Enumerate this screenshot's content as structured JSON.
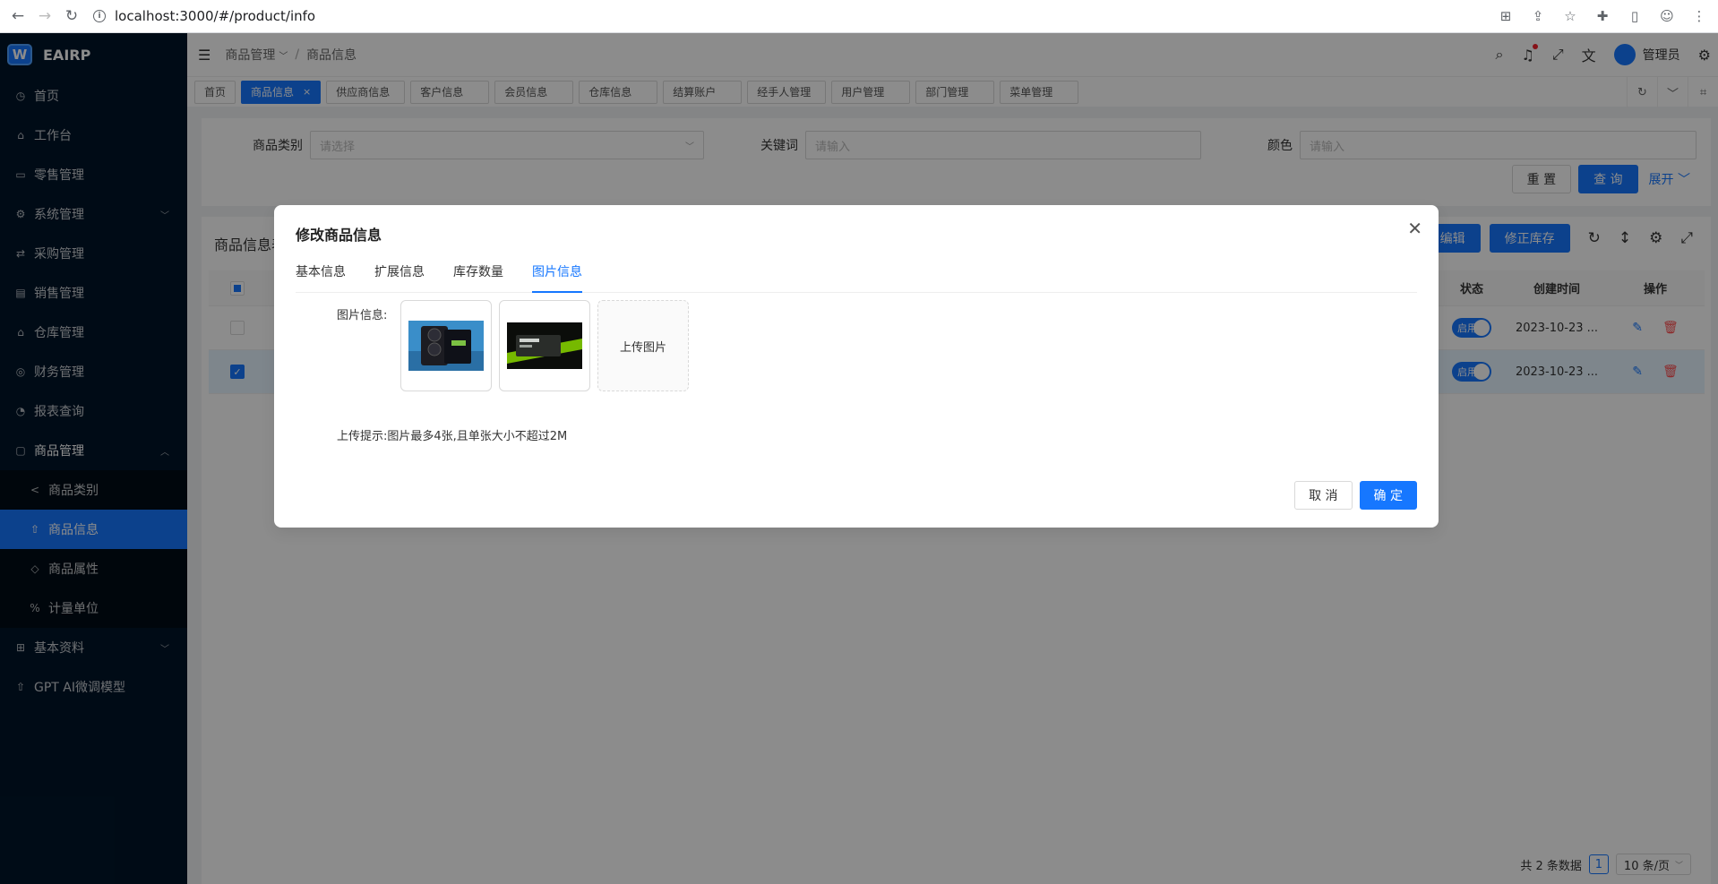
{
  "browser": {
    "url": "localhost:3000/#/product/info"
  },
  "sidebar": {
    "logo": "EAIRP",
    "items": [
      {
        "label": "首页",
        "icon": "dashboard-icon"
      },
      {
        "label": "工作台",
        "icon": "home-icon"
      },
      {
        "label": "零售管理",
        "icon": "folder-icon"
      },
      {
        "label": "系统管理",
        "icon": "gear-icon"
      },
      {
        "label": "采购管理",
        "icon": "swap-icon"
      },
      {
        "label": "销售管理",
        "icon": "bank-icon"
      },
      {
        "label": "仓库管理",
        "icon": "warehouse-icon"
      },
      {
        "label": "财务管理",
        "icon": "finance-icon"
      },
      {
        "label": "报表查询",
        "icon": "report-icon"
      },
      {
        "label": "商品管理",
        "icon": "shopping-icon"
      }
    ],
    "sub_items": [
      {
        "label": "商品类别",
        "icon": "share-icon"
      },
      {
        "label": "商品信息",
        "icon": "rocket-icon"
      },
      {
        "label": "商品属性",
        "icon": "tag-icon"
      },
      {
        "label": "计量单位",
        "icon": "percent-icon"
      }
    ],
    "bottom_items": [
      {
        "label": "基本资料",
        "icon": "grid-icon"
      },
      {
        "label": "GPT AI微调模型",
        "icon": "rocket-icon"
      }
    ]
  },
  "header": {
    "breadcrumb_parent": "商品管理",
    "breadcrumb_current": "商品信息",
    "user_name": "管理员"
  },
  "tabs": [
    "首页",
    "商品信息",
    "供应商信息",
    "客户信息",
    "会员信息",
    "仓库信息",
    "结算账户",
    "经手人管理",
    "用户管理",
    "部门管理",
    "菜单管理"
  ],
  "search": {
    "category_label": "商品类别",
    "category_placeholder": "请选择",
    "keyword_label": "关键词",
    "keyword_placeholder": "请输入",
    "color_label": "颜色",
    "color_placeholder": "请输入",
    "reset_label": "重 置",
    "query_label": "查 询",
    "expand_label": "展开"
  },
  "table": {
    "title": "商品信息表",
    "edit_label": "编辑",
    "fix_stock_label": "修正库存",
    "col_status": "状态",
    "col_created": "创建时间",
    "col_ops": "操作",
    "rows": [
      {
        "status": "启用",
        "created": "2023-10-23 ..."
      },
      {
        "status": "启用",
        "created": "2023-10-23 ..."
      }
    ],
    "total_text": "共 2 条数据",
    "page": "1",
    "page_size": "10 条/页"
  },
  "modal": {
    "title": "修改商品信息",
    "tabs": [
      "基本信息",
      "扩展信息",
      "库存数量",
      "图片信息"
    ],
    "active_tab": 3,
    "image_label": "图片信息:",
    "upload_label": "上传图片",
    "hint": "上传提示:图片最多4张,且单张大小不超过2M",
    "cancel_label": "取 消",
    "ok_label": "确 定"
  },
  "colors": {
    "primary": "#1677ff",
    "sidebar_bg": "#001529",
    "danger": "#ff4d4f"
  }
}
